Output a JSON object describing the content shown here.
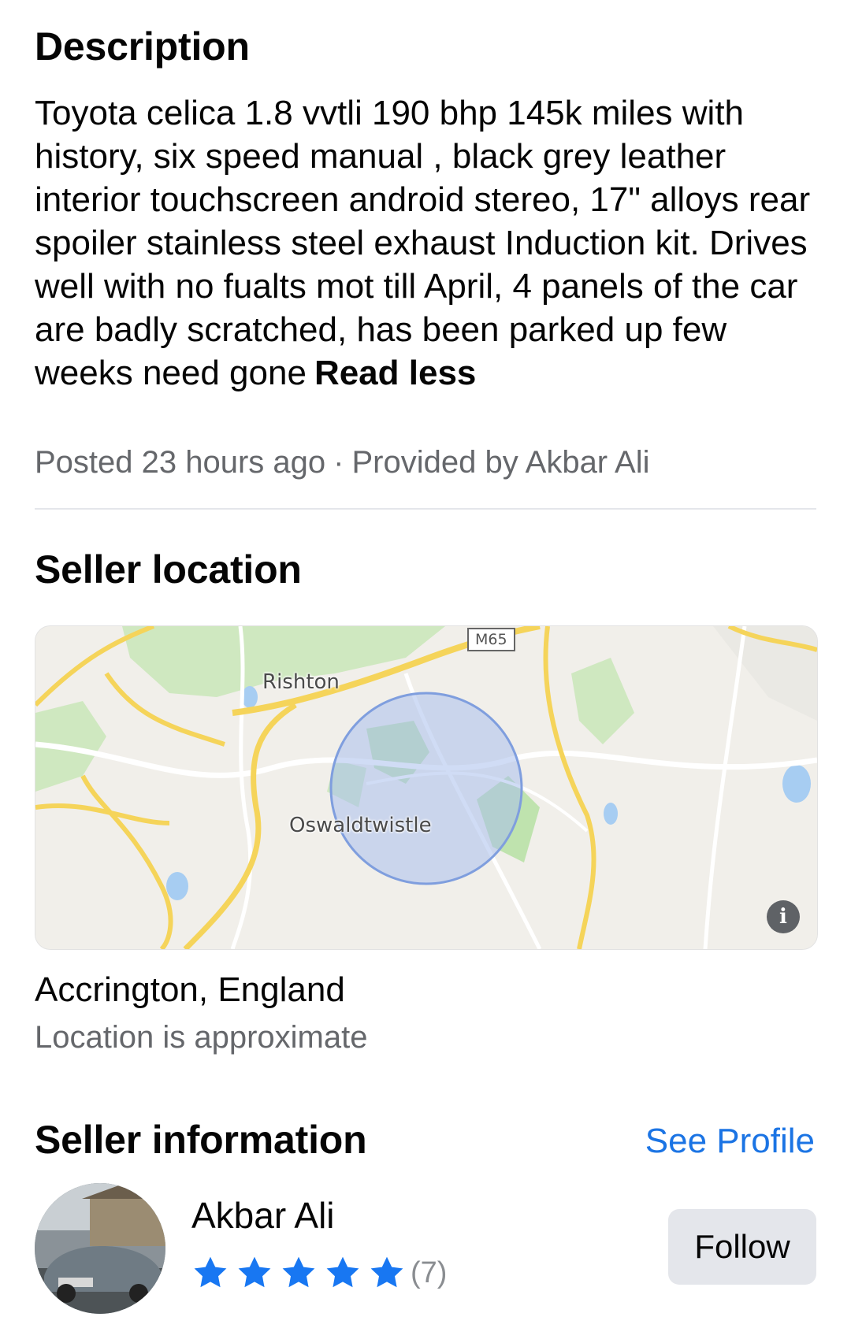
{
  "description": {
    "heading": "Description",
    "text": "Toyota celica 1.8 vvtli 190 bhp 145k miles with history, six speed manual , black grey leather interior touchscreen android stereo, 17\" alloys rear spoiler stainless steel exhaust Induction kit. Drives well with no fualts mot till April, 4 panels of the car are badly scratched, has been parked up few weeks need gone",
    "read_less_label": "Read less"
  },
  "meta": {
    "posted": "Posted 23 hours ago",
    "separator": "·",
    "provided_by": "Provided by Akbar Ali"
  },
  "seller_location": {
    "heading": "Seller location",
    "map": {
      "labels": {
        "town_1": "Rishton",
        "town_2": "Oswaldtwistle",
        "motorway": "M65"
      },
      "info_icon": "info-icon",
      "radius_color": "#7f9ede"
    },
    "city": "Accrington, England",
    "approx_note": "Location is approximate"
  },
  "seller_information": {
    "heading": "Seller information",
    "see_profile_label": "See Profile",
    "name": "Akbar Ali",
    "rating_stars": 5,
    "rating_count": "(7)",
    "follow_label": "Follow",
    "star_color": "#1877f2",
    "link_color": "#1b74e4"
  }
}
